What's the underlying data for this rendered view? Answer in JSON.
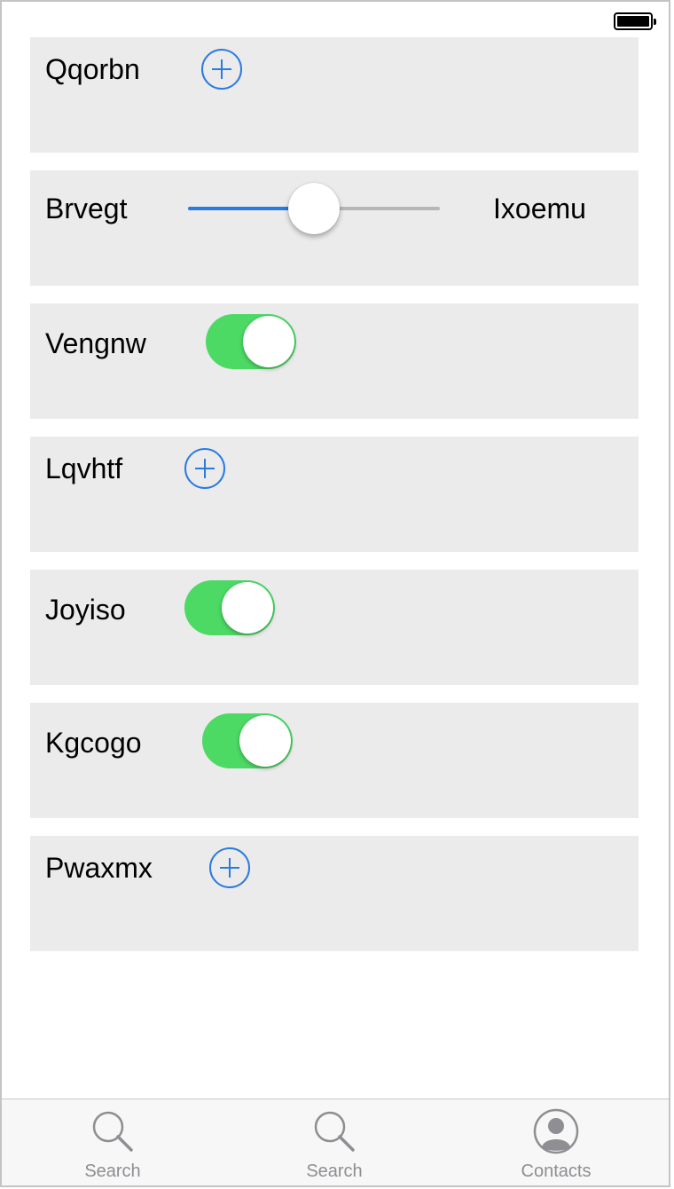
{
  "status_bar": {
    "battery_icon": "battery-full-icon"
  },
  "rows": [
    {
      "label": "Qqorbn",
      "control": "add-button",
      "icon": "plus-circle-icon"
    },
    {
      "label": "Brvegt",
      "control": "slider",
      "slider_value": 0.5,
      "max_label": "Ixoemu"
    },
    {
      "label": "Vengnw",
      "control": "toggle",
      "on": true
    },
    {
      "label": "Lqvhtf",
      "control": "add-button",
      "icon": "plus-circle-icon"
    },
    {
      "label": "Joyiso",
      "control": "toggle",
      "on": true
    },
    {
      "label": "Kgcogo",
      "control": "toggle",
      "on": true
    },
    {
      "label": "Pwaxmx",
      "control": "add-button",
      "icon": "plus-circle-icon"
    }
  ],
  "tabbar": {
    "tabs": [
      {
        "label": "Search",
        "icon": "search-icon"
      },
      {
        "label": "Search",
        "icon": "search-icon"
      },
      {
        "label": "Contacts",
        "icon": "contacts-icon"
      }
    ]
  },
  "colors": {
    "accent": "#2a7ae2",
    "toggle_on": "#4cd964",
    "row_background": "#ebebeb",
    "tab_inactive": "#8e8e93"
  }
}
